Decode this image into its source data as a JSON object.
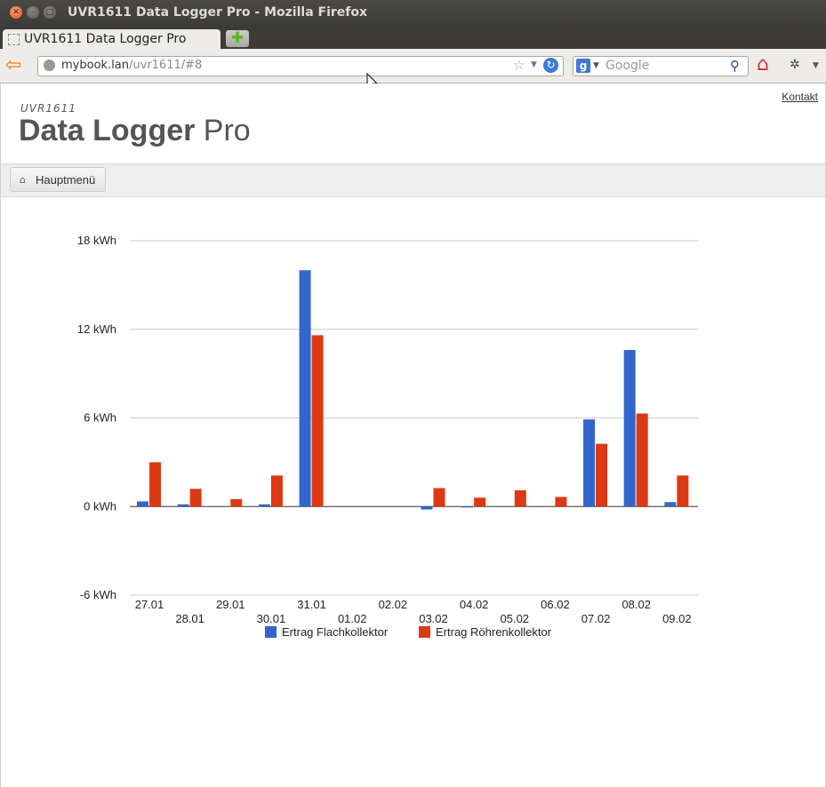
{
  "window": {
    "title": "UVR1611 Data Logger Pro - Mozilla Firefox"
  },
  "tab": {
    "label": "UVR1611 Data Logger Pro"
  },
  "urlbar": {
    "host": "mybook.lan",
    "path": "/uvr1611/#8"
  },
  "search": {
    "placeholder": "Google"
  },
  "header": {
    "small_title": "UVR1611",
    "title_bold": "Data Logger",
    "title_light": " Pro",
    "contact_link": "Kontakt"
  },
  "menu": {
    "main_menu_label": "Hauptmenü"
  },
  "icons": {
    "back": "back-arrow-icon",
    "reload": "reload-icon",
    "bookmark": "star-icon",
    "search": "magnifier-icon",
    "home": "home-icon",
    "new_tab": "plus-icon"
  },
  "chart_data": {
    "type": "bar",
    "categories": [
      "27.01",
      "28.01",
      "29.01",
      "30.01",
      "31.01",
      "01.02",
      "02.02",
      "03.02",
      "04.02",
      "05.02",
      "06.02",
      "07.02",
      "08.02",
      "09.02"
    ],
    "series": [
      {
        "name": "Ertrag Flachkollektor",
        "color": "#3366cc",
        "values": [
          0.35,
          0.15,
          0,
          0.15,
          16.0,
          0,
          0,
          -0.2,
          -0.05,
          0,
          0,
          5.9,
          10.6,
          0.3
        ]
      },
      {
        "name": "Ertrag Röhrenkollektor",
        "color": "#dc3912",
        "values": [
          3.0,
          1.2,
          0.5,
          2.1,
          11.6,
          0,
          0,
          1.25,
          0.6,
          1.1,
          0.65,
          4.25,
          6.3,
          2.1
        ]
      }
    ],
    "ylim": [
      -6,
      18
    ],
    "yticks": [
      -6,
      0,
      6,
      12,
      18
    ],
    "ytick_labels": [
      "-6 kWh",
      "0 kWh",
      "6 kWh",
      "12 kWh",
      "18 kWh"
    ],
    "grid": true,
    "legend_position": "bottom"
  }
}
